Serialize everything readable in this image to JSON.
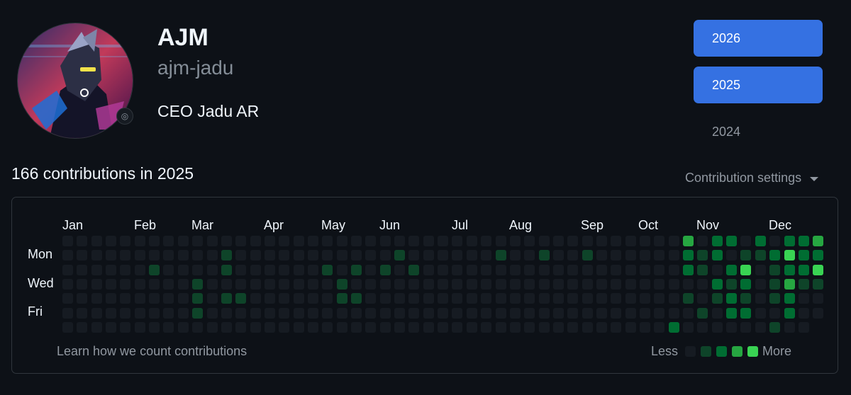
{
  "profile": {
    "name": "AJM",
    "username": "ajm-jadu",
    "bio": "CEO Jadu AR"
  },
  "years": [
    "2026",
    "2025",
    "2024"
  ],
  "contributions": {
    "title": "166 contributions in 2025",
    "settings_label": "Contribution settings",
    "learn_link": "Learn how we count contributions",
    "legend_less": "Less",
    "legend_more": "More",
    "months": [
      "Jan",
      "Feb",
      "Mar",
      "Apr",
      "May",
      "Jun",
      "Jul",
      "Aug",
      "Sep",
      "Oct",
      "Nov",
      "Dec"
    ],
    "days": [
      "Mon",
      "Wed",
      "Fri"
    ],
    "level_colors": [
      "#161b22",
      "#0e4429",
      "#006d32",
      "#26a641",
      "#39d353"
    ],
    "grid_levels": [
      [
        0,
        0,
        0,
        0,
        0,
        0,
        0,
        0,
        0,
        0,
        0,
        0,
        0,
        0,
        0,
        0,
        0,
        0,
        0,
        0,
        0,
        0,
        0,
        0,
        0,
        0,
        0,
        0,
        0,
        0,
        0,
        0,
        0,
        0,
        0,
        0,
        0,
        0,
        0,
        0,
        0,
        0,
        0,
        3,
        0,
        2,
        2,
        0,
        2,
        0,
        2,
        2,
        3
      ],
      [
        0,
        0,
        0,
        0,
        0,
        0,
        0,
        0,
        0,
        0,
        0,
        1,
        0,
        0,
        0,
        0,
        0,
        0,
        0,
        0,
        0,
        0,
        0,
        1,
        0,
        0,
        0,
        0,
        0,
        0,
        1,
        0,
        0,
        1,
        0,
        0,
        1,
        0,
        0,
        0,
        0,
        0,
        0,
        2,
        1,
        2,
        0,
        1,
        1,
        2,
        4,
        2,
        2
      ],
      [
        0,
        0,
        0,
        0,
        0,
        0,
        1,
        0,
        0,
        0,
        0,
        1,
        0,
        0,
        0,
        0,
        0,
        0,
        1,
        0,
        1,
        0,
        1,
        0,
        1,
        0,
        0,
        0,
        0,
        0,
        0,
        0,
        0,
        0,
        0,
        0,
        0,
        0,
        0,
        0,
        0,
        0,
        0,
        2,
        1,
        0,
        2,
        4,
        0,
        1,
        2,
        2,
        4
      ],
      [
        0,
        0,
        0,
        0,
        0,
        0,
        0,
        0,
        0,
        1,
        0,
        0,
        0,
        0,
        0,
        0,
        0,
        0,
        0,
        1,
        0,
        0,
        0,
        0,
        0,
        0,
        0,
        0,
        0,
        0,
        0,
        0,
        0,
        0,
        0,
        0,
        0,
        0,
        0,
        0,
        0,
        0,
        0,
        0,
        0,
        2,
        1,
        2,
        0,
        1,
        3,
        1,
        1
      ],
      [
        0,
        0,
        0,
        0,
        0,
        0,
        0,
        0,
        0,
        1,
        0,
        1,
        1,
        0,
        0,
        0,
        0,
        0,
        0,
        1,
        1,
        0,
        0,
        0,
        0,
        0,
        0,
        0,
        0,
        0,
        0,
        0,
        0,
        0,
        0,
        0,
        0,
        0,
        0,
        0,
        0,
        0,
        0,
        1,
        0,
        1,
        2,
        1,
        0,
        1,
        2,
        0,
        0
      ],
      [
        0,
        0,
        0,
        0,
        0,
        0,
        0,
        0,
        0,
        1,
        0,
        0,
        0,
        0,
        0,
        0,
        0,
        0,
        0,
        0,
        0,
        0,
        0,
        0,
        0,
        0,
        0,
        0,
        0,
        0,
        0,
        0,
        0,
        0,
        0,
        0,
        0,
        0,
        0,
        0,
        0,
        0,
        0,
        0,
        1,
        0,
        2,
        2,
        0,
        0,
        2,
        0,
        0
      ],
      [
        0,
        0,
        0,
        0,
        0,
        0,
        0,
        0,
        0,
        0,
        0,
        0,
        0,
        0,
        0,
        0,
        0,
        0,
        0,
        0,
        0,
        0,
        0,
        0,
        0,
        0,
        0,
        0,
        0,
        0,
        0,
        0,
        0,
        0,
        0,
        0,
        0,
        0,
        0,
        0,
        0,
        0,
        2,
        0,
        0,
        0,
        0,
        0,
        0,
        1,
        0,
        0,
        0
      ]
    ]
  }
}
